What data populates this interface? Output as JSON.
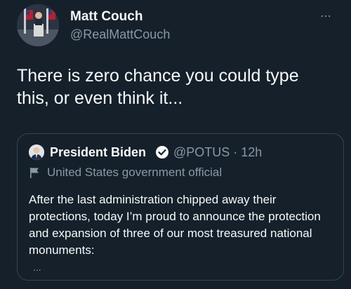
{
  "author": {
    "name": "Matt Couch",
    "handle": "@RealMattCouch"
  },
  "tweet": {
    "text": "There is zero chance you could type this, or even think it...",
    "more_icon": "⋯"
  },
  "quoted": {
    "name": "President Biden",
    "handle_time": "@POTUS · 12h",
    "label": "United States government official",
    "text": "After the last administration chipped away their protections, today I’m proud to announce the protection and expansion of three of our most treasured national monuments:",
    "more": "..."
  },
  "colors": {
    "background": "#15202b",
    "text_primary": "#f7f9f9",
    "text_secondary": "#8b98a5",
    "border": "#38444d",
    "verified": "#1d9bf0"
  }
}
